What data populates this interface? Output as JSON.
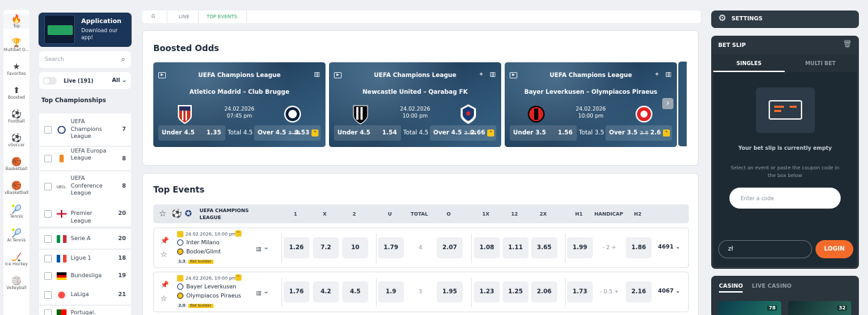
{
  "rail": [
    {
      "icon": "🔥",
      "label": "Top",
      "active": true
    },
    {
      "icon": "🏆",
      "label": "Multibet O..."
    },
    {
      "icon": "★",
      "label": "Favorites"
    },
    {
      "icon": "⬆",
      "label": "Boosted"
    },
    {
      "icon": "⚽",
      "label": "Football"
    },
    {
      "icon": "⚽",
      "label": "vSoccer"
    },
    {
      "icon": "🏀",
      "label": "Basketball"
    },
    {
      "icon": "🏀",
      "label": "vBasketball"
    },
    {
      "icon": "🎾",
      "label": "Tennis"
    },
    {
      "icon": "🎾",
      "label": "AI Tennis"
    },
    {
      "icon": "🏒",
      "label": "Ice Hockey"
    },
    {
      "icon": "🏐",
      "label": "Volleyball"
    }
  ],
  "promo": {
    "title": "Application",
    "subtitle": "Download our app!"
  },
  "search": {
    "placeholder": "Search"
  },
  "live": {
    "label": "Live (191)",
    "filter": "All"
  },
  "top_championships": {
    "title": "Top Championships",
    "items": [
      {
        "name": "UEFA Champions League",
        "count": "7"
      },
      {
        "name": "UEFA Europa League",
        "count": "8"
      },
      {
        "name": "UEFA Conference League",
        "count": "8"
      },
      {
        "name": "Premier League",
        "count": "20"
      },
      {
        "name": "Serie A",
        "count": "20"
      },
      {
        "name": "Ligue 1",
        "count": "18"
      },
      {
        "name": "Bundesliga",
        "count": "19"
      },
      {
        "name": "LaLiga",
        "count": "21"
      },
      {
        "name": "Portugal.",
        "count": ""
      }
    ]
  },
  "breadcrumb": {
    "items": [
      "LINE",
      "TOP EVENTS"
    ]
  },
  "boosted": {
    "title": "Boosted Odds",
    "cards": [
      {
        "league": "UEFA Champions League",
        "match": "Atletico Madrid – Club Brugge",
        "date": "24.02.2026",
        "time": "07:45 pm",
        "under_label": "Under 4.5",
        "under_val": "1.35",
        "total": "Total 4.5",
        "over_label": "Over 4.5",
        "old": "3.35",
        "new": "3.53"
      },
      {
        "league": "UEFA Champions League",
        "match": "Newcastle United – Qarabag FK",
        "date": "24.02.2026",
        "time": "10:00 pm",
        "under_label": "Under 4.5",
        "under_val": "1.54",
        "total": "Total 4.5",
        "over_label": "Over 4.5",
        "old": "2.55",
        "new": "2.66"
      },
      {
        "league": "UEFA Champions League",
        "match": "Bayer Leverkusen – Olympiacos Piraeus",
        "date": "24.02.2026",
        "time": "10:00 pm",
        "under_label": "Under 3.5",
        "under_val": "1.56",
        "total": "Total 3.5",
        "over_label": "Over 3.5",
        "old": "2.5",
        "new": "2.6"
      }
    ]
  },
  "top_events": {
    "title": "Top Events",
    "league": "UEFA CHAMPIONS LEAGUE",
    "headers": [
      "1",
      "X",
      "2",
      "U",
      "TOTAL",
      "O",
      "1X",
      "12",
      "2X",
      "H1",
      "HANDICAP",
      "H2"
    ],
    "rows": [
      {
        "datetime": "24.02.2026, 10:00 pm",
        "team1": "Inter Milano",
        "team2": "Bodoe/Glimt",
        "badge": "1.3",
        "builder": "Bet builder",
        "odds": [
          "1.26",
          "7.2",
          "10",
          "1.79",
          "4",
          "2.07",
          "1.08",
          "1.11",
          "3.65",
          "1.99",
          "- 2 +",
          "1.86"
        ],
        "more": "4691"
      },
      {
        "datetime": "24.02.2026, 10:00 pm",
        "team1": "Bayer Leverkusen",
        "team2": "Olympiacos Piraeus",
        "badge": "2.0",
        "builder": "Bet builder",
        "odds": [
          "1.76",
          "4.2",
          "4.5",
          "1.9",
          "3",
          "1.95",
          "1.23",
          "1.25",
          "2.06",
          "1.73",
          "- 0.5 +",
          "2.16"
        ],
        "more": "4067"
      }
    ]
  },
  "settings": {
    "label": "SETTINGS"
  },
  "betslip": {
    "title": "BET SLIP",
    "tab_singles": "SINGLES",
    "tab_multi": "MULTI BET",
    "empty_title": "Your bet slip is currently empty",
    "empty_hint": "Select an event or paste the coupon code in the box below",
    "code_placeholder": "Enter a code",
    "currency": "zł",
    "login": "LOGIN"
  },
  "casino": {
    "tab1": "CASINO",
    "tab2": "LIVE CASINO",
    "game1_badge": "78",
    "game2_badge": "32"
  }
}
